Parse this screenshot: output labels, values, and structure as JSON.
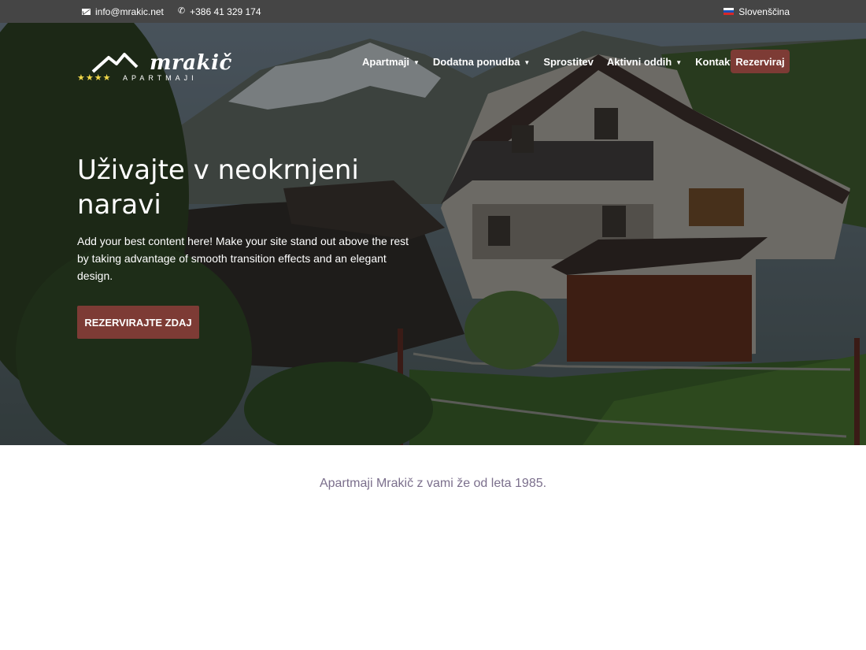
{
  "topbar": {
    "email": "info@mrakic.net",
    "phone": "+386 41 329 174",
    "language": "Slovenščina"
  },
  "logo": {
    "name": "mrakič",
    "subtitle": "APARTMAJI",
    "stars": "★★★★"
  },
  "nav": {
    "items": [
      {
        "label": "Apartmaji",
        "has_dropdown": true
      },
      {
        "label": "Dodatna ponudba",
        "has_dropdown": true
      },
      {
        "label": "Sprostitev",
        "has_dropdown": false
      },
      {
        "label": "Aktivni oddih",
        "has_dropdown": true
      },
      {
        "label": "Kontakt",
        "has_dropdown": false
      }
    ],
    "reserve_label": "Rezerviraj"
  },
  "hero": {
    "headline": "Uživajte v neokrnjeni naravi",
    "text": "Add your best content here! Make your site stand out above the rest by taking advantage of smooth transition effects and an elegant design.",
    "cta_label": "REZERVIRAJTE ZDAJ"
  },
  "tagline": "Apartmaji Mrakič z vami že od leta 1985.",
  "colors": {
    "accent": "#7d3b35",
    "topbar": "#454545",
    "tagline": "#7b6f8c"
  }
}
